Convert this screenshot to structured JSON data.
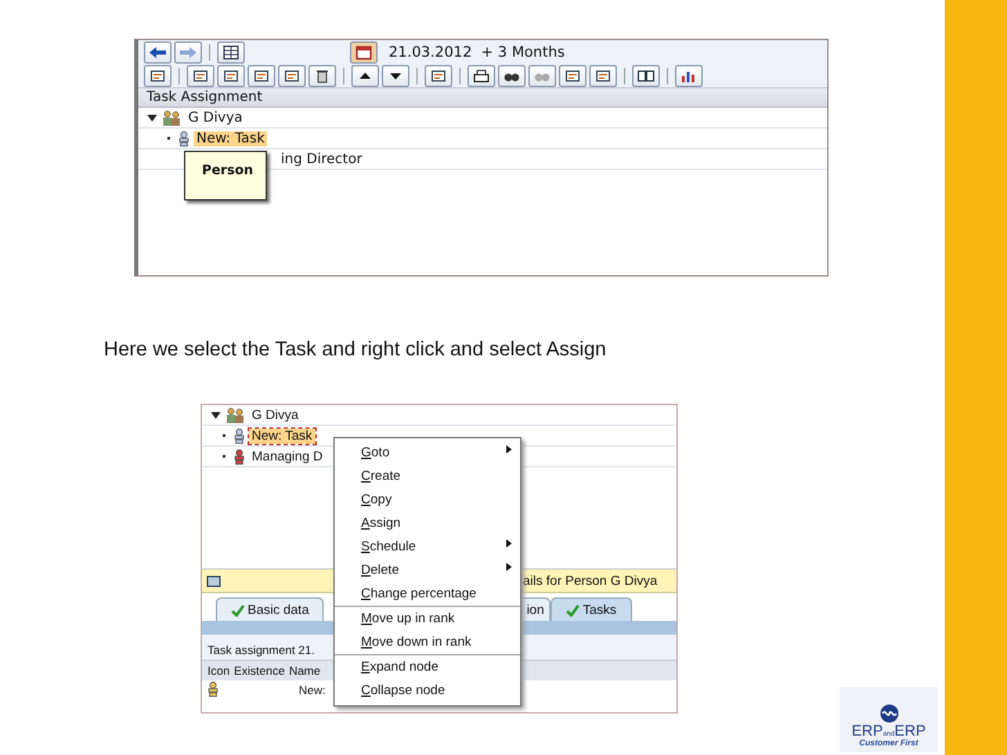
{
  "slide": {
    "caption": "Here we select the Task and right click and select Assign"
  },
  "screenshot_1": {
    "date_range": "21.03.2012  + 3 Months",
    "panel_title": "Task Assignment",
    "tree": [
      {
        "label": "G Divya",
        "kind": "org",
        "expanded": true,
        "selected": false,
        "children": [
          {
            "label": "New: Task",
            "kind": "person",
            "selected": true
          },
          {
            "label": "ing Director",
            "kind": "hidden",
            "selected": false
          }
        ]
      }
    ],
    "tooltip": "Person"
  },
  "screenshot_2": {
    "tree": [
      {
        "label": "G Divya",
        "kind": "org",
        "expanded": true,
        "selected": false,
        "children": [
          {
            "label": "New: Task",
            "kind": "person",
            "selected": true
          },
          {
            "label": "Managing D",
            "kind": "position",
            "selected": false
          }
        ]
      }
    ],
    "info_bar": "ails for Person G Divya",
    "tabs": [
      {
        "label": "Basic data",
        "checked": true,
        "selected": false
      },
      {
        "label": "ion",
        "checked": false,
        "selected": false
      },
      {
        "label": "Tasks",
        "checked": true,
        "selected": true
      }
    ],
    "table_title": "Task assignment 21.",
    "columns": [
      "Icon",
      "Existence",
      "Name"
    ],
    "rows": [
      {
        "name": "New:"
      }
    ],
    "context_menu": [
      {
        "label": "Goto",
        "submenu": true,
        "divider_above": false
      },
      {
        "label": "Create",
        "submenu": false,
        "divider_above": false
      },
      {
        "label": "Copy",
        "submenu": false,
        "divider_above": false
      },
      {
        "label": "Assign",
        "submenu": false,
        "divider_above": false
      },
      {
        "label": "Schedule",
        "submenu": true,
        "divider_above": false
      },
      {
        "label": "Delete",
        "submenu": true,
        "divider_above": false
      },
      {
        "label": "Change percentage",
        "submenu": false,
        "divider_above": false
      },
      {
        "label": "Move up in rank",
        "submenu": false,
        "divider_above": true
      },
      {
        "label": "Move down in rank",
        "submenu": false,
        "divider_above": false
      },
      {
        "label": "Expand node",
        "submenu": false,
        "divider_above": true
      },
      {
        "label": "Collapse node",
        "submenu": false,
        "divider_above": false
      }
    ]
  },
  "logo": {
    "wordmark": [
      "ERP",
      "and",
      "ERP"
    ],
    "tagline": "Customer First"
  }
}
